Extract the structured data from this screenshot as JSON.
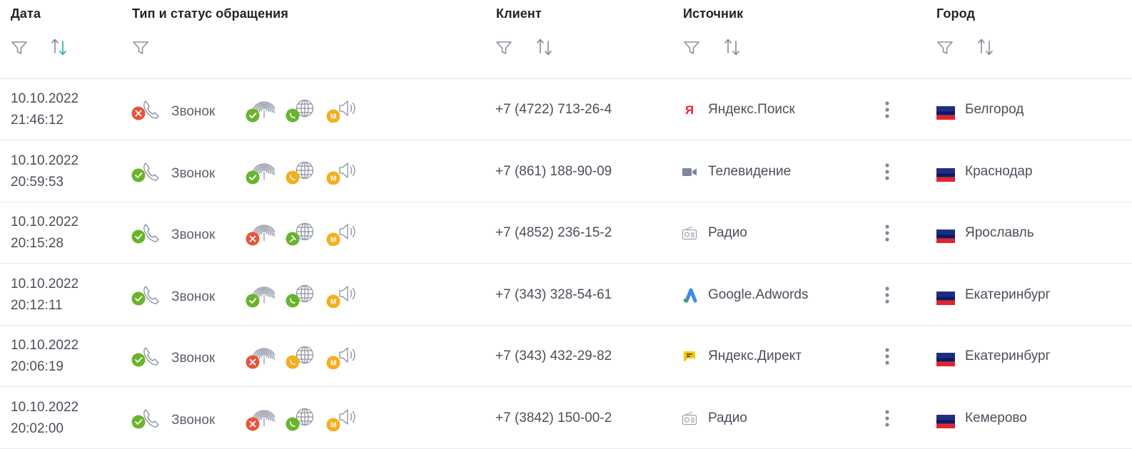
{
  "header": {
    "date": "Дата",
    "type_status": "Тип и статус обращения",
    "client": "Клиент",
    "source": "Источник",
    "city": "Город"
  },
  "icons": {
    "filter": "filter-icon",
    "sort": "sort-icon",
    "kebab": "more-vertical-icon"
  },
  "colors": {
    "green": "#6ab42c",
    "red": "#e5563b",
    "orange": "#f2b01e",
    "teal": "#2ab3a4",
    "icon_gray": "#8a90a0"
  },
  "rows": [
    {
      "date": "10.10.2022",
      "time": "21:46:12",
      "type": "Звонок",
      "call_status": "missed",
      "fingerprint": "ok",
      "site": "ok",
      "mark": "M",
      "phone": "+7 (4722) 713-26-4",
      "source": "Яндекс.Поиск",
      "source_icon": "yandex",
      "city": "Белгород"
    },
    {
      "date": "10.10.2022",
      "time": "20:59:53",
      "type": "Звонок",
      "call_status": "ok",
      "fingerprint": "ok",
      "site": "pending",
      "mark": "M",
      "phone": "+7 (861) 188-90-09",
      "source": "Телевидение",
      "source_icon": "tv",
      "city": "Краснодар"
    },
    {
      "date": "10.10.2022",
      "time": "20:15:28",
      "type": "Звонок",
      "call_status": "ok",
      "fingerprint": "fail",
      "site": "pinned",
      "mark": "M",
      "phone": "+7 (4852) 236-15-2",
      "source": "Радио",
      "source_icon": "radio",
      "city": "Ярославль"
    },
    {
      "date": "10.10.2022",
      "time": "20:12:11",
      "type": "Звонок",
      "call_status": "ok",
      "fingerprint": "ok",
      "site": "ok",
      "mark": "M",
      "phone": "+7 (343) 328-54-61",
      "source": "Google.Adwords",
      "source_icon": "google-ads",
      "city": "Екатеринбург"
    },
    {
      "date": "10.10.2022",
      "time": "20:06:19",
      "type": "Звонок",
      "call_status": "ok",
      "fingerprint": "fail",
      "site": "pending",
      "mark": "M",
      "phone": "+7 (343) 432-29-82",
      "source": "Яндекс.Директ",
      "source_icon": "yandex-direct",
      "city": "Екатеринбург"
    },
    {
      "date": "10.10.2022",
      "time": "20:02:00",
      "type": "Звонок",
      "call_status": "ok",
      "fingerprint": "fail",
      "site": "ok",
      "mark": "M",
      "phone": "+7 (3842) 150-00-2",
      "source": "Радио",
      "source_icon": "radio",
      "city": "Кемерово"
    }
  ]
}
